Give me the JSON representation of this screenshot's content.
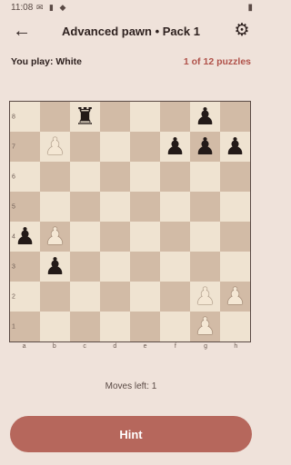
{
  "status_bar": {
    "time": "11:08",
    "icons_left": "✉ ▮ ◆",
    "battery_icon": "battery-icon"
  },
  "app_bar": {
    "title": "Advanced pawn • Pack 1",
    "back_icon": "arrow-back-icon",
    "settings_icon": "gear-icon"
  },
  "info": {
    "you_play": "You play: White",
    "puzzle_count": "1 of 12 puzzles"
  },
  "board": {
    "files": [
      "a",
      "b",
      "c",
      "d",
      "e",
      "f",
      "g",
      "h"
    ],
    "ranks": [
      "8",
      "7",
      "6",
      "5",
      "4",
      "3",
      "2",
      "1"
    ],
    "pieces": [
      {
        "square": "c8",
        "color": "black",
        "type": "rook",
        "glyph": "♜"
      },
      {
        "square": "g8",
        "color": "black",
        "type": "pawn",
        "glyph": "♟"
      },
      {
        "square": "b7",
        "color": "white",
        "type": "pawn",
        "glyph": "♟"
      },
      {
        "square": "f7",
        "color": "black",
        "type": "pawn",
        "glyph": "♟"
      },
      {
        "square": "g7",
        "color": "black",
        "type": "pawn",
        "glyph": "♟"
      },
      {
        "square": "h7",
        "color": "black",
        "type": "pawn",
        "glyph": "♟"
      },
      {
        "square": "a4",
        "color": "black",
        "type": "pawn",
        "glyph": "♟"
      },
      {
        "square": "b4",
        "color": "white",
        "type": "pawn",
        "glyph": "♟"
      },
      {
        "square": "b3",
        "color": "black",
        "type": "pawn",
        "glyph": "♟"
      },
      {
        "square": "g2",
        "color": "white",
        "type": "pawn",
        "glyph": "♟"
      },
      {
        "square": "h2",
        "color": "white",
        "type": "pawn",
        "glyph": "♟"
      },
      {
        "square": "g1",
        "color": "white",
        "type": "pawn",
        "glyph": "♟"
      }
    ]
  },
  "footer": {
    "moves_left": "Moves left: 1",
    "hint_label": "Hint"
  },
  "colors": {
    "background": "#efe2da",
    "accent": "#b6675c",
    "count_text": "#b0524a",
    "light_square": "#efe3d1",
    "dark_square": "#d2bba6"
  }
}
